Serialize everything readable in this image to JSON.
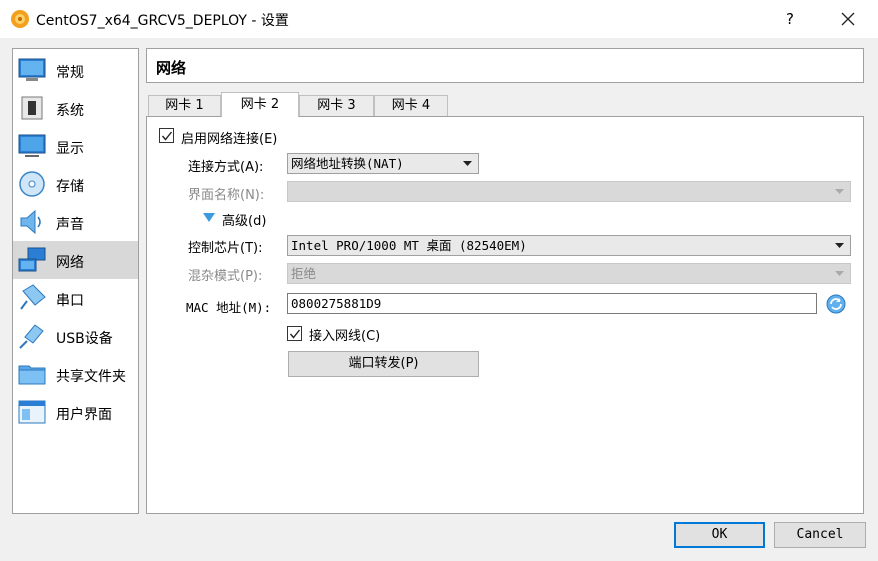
{
  "window": {
    "title": "CentOS7_x64_GRCV5_DEPLOY - 设置",
    "help_label": "?"
  },
  "sidebar": {
    "items": [
      {
        "label": "常规",
        "icon": "general-icon"
      },
      {
        "label": "系统",
        "icon": "system-icon"
      },
      {
        "label": "显示",
        "icon": "display-icon"
      },
      {
        "label": "存储",
        "icon": "storage-icon"
      },
      {
        "label": "声音",
        "icon": "audio-icon"
      },
      {
        "label": "网络",
        "icon": "network-icon",
        "selected": true
      },
      {
        "label": "串口",
        "icon": "serial-port-icon"
      },
      {
        "label": "USB设备",
        "icon": "usb-icon"
      },
      {
        "label": "共享文件夹",
        "icon": "shared-folder-icon"
      },
      {
        "label": "用户界面",
        "icon": "user-interface-icon"
      }
    ]
  },
  "section": {
    "title": "网络"
  },
  "tabs": [
    {
      "label": "网卡 1"
    },
    {
      "label": "网卡 2",
      "active": true
    },
    {
      "label": "网卡 3"
    },
    {
      "label": "网卡 4"
    }
  ],
  "adapter": {
    "enable_label": "启用网络连接(E)",
    "enable_checked": true,
    "attached_to_label": "连接方式(A):",
    "attached_to_value": "网络地址转换(NAT)",
    "name_label": "界面名称(N):",
    "name_value": "",
    "advanced_label": "高级(d)",
    "adapter_type_label": "控制芯片(T):",
    "adapter_type_value": "Intel PRO/1000 MT 桌面 (82540EM)",
    "promiscuous_label": "混杂模式(P):",
    "promiscuous_value": "拒绝",
    "mac_label": "MAC 地址(M):",
    "mac_value": "0800275881D9",
    "cable_label": "接入网线(C)",
    "cable_checked": true,
    "port_forwarding_label": "端口转发(P)"
  },
  "footer": {
    "ok_label": "OK",
    "cancel_label": "Cancel"
  },
  "colors": {
    "accent": "#0078d7",
    "selected_bg": "#d8d8d8",
    "disabled_text": "#8a8a8a"
  }
}
